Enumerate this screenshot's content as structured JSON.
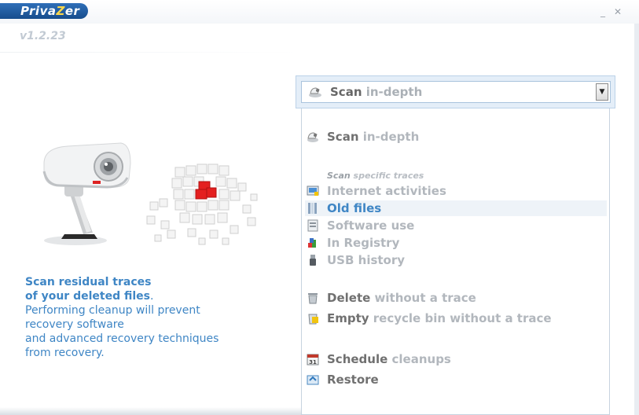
{
  "app": {
    "logo_pre": "Priva",
    "logo_z": "Z",
    "logo_post": "er",
    "version": "v1.2.23",
    "minimize": "_",
    "close": "✕"
  },
  "description": {
    "heading_line1": "Scan residual traces",
    "heading_line2": "of your deleted files",
    "heading_end": ".",
    "body_line1": "Performing cleanup will prevent",
    "body_line2": "recovery software",
    "body_line3": "and advanced recovery techniques",
    "body_line4": "from recovery."
  },
  "dropdown": {
    "selected_dark": "Scan",
    "selected_light": " in-depth",
    "arrow": "▼"
  },
  "menu": {
    "scan_indepth_dark": "Scan",
    "scan_indepth_light": " in-depth",
    "section_dark": "Scan",
    "section_light": " specific traces",
    "internet": "Internet activities",
    "old_files": "Old files",
    "software_use": "Software use",
    "registry": "In Registry",
    "usb": "USB history",
    "delete_dark": "Delete",
    "delete_light": " without a trace",
    "empty_dark": "Empty",
    "empty_light": " recycle bin without a trace",
    "schedule_dark": "Schedule",
    "schedule_light": " cleanups",
    "restore": "Restore"
  },
  "colors": {
    "accent": "#3f86c5",
    "logo_bg": "#1f5fa6"
  }
}
